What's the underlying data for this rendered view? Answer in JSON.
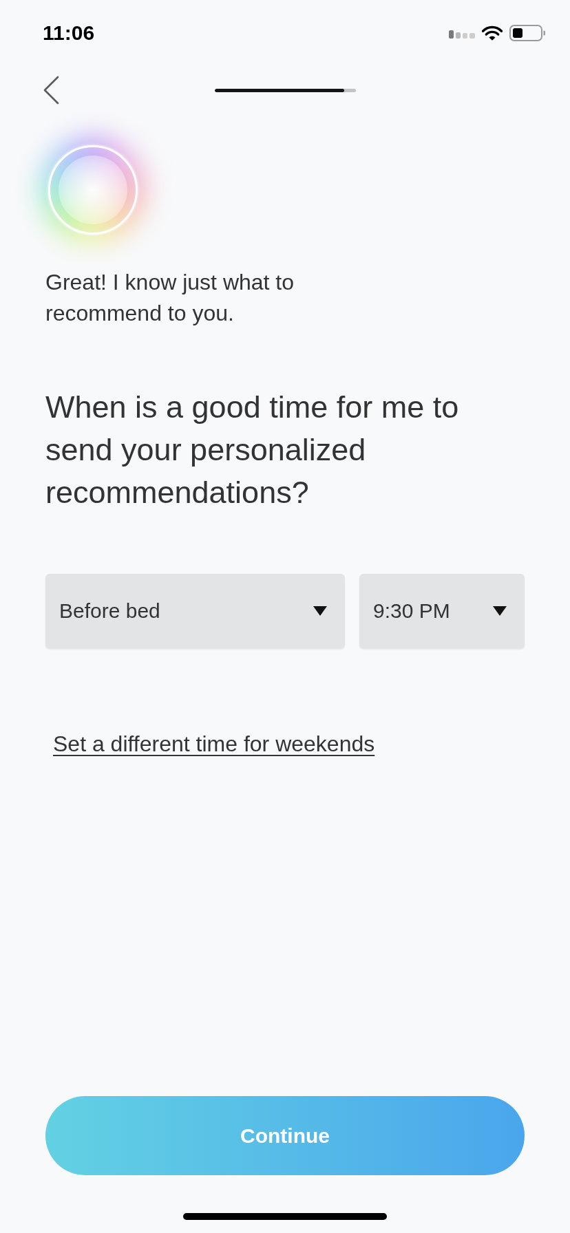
{
  "status_bar": {
    "time": "11:06"
  },
  "progress": {
    "level": 0.92
  },
  "message": "Great! I know just what to recommend to you.",
  "question": "When is a good time for me to send your personalized recommendations?",
  "dropdowns": [
    {
      "value": "Before bed"
    },
    {
      "value": "9:30 PM"
    }
  ],
  "weekend_link": "Set a different time for weekends",
  "continue_button": {
    "label": "Continue"
  }
}
